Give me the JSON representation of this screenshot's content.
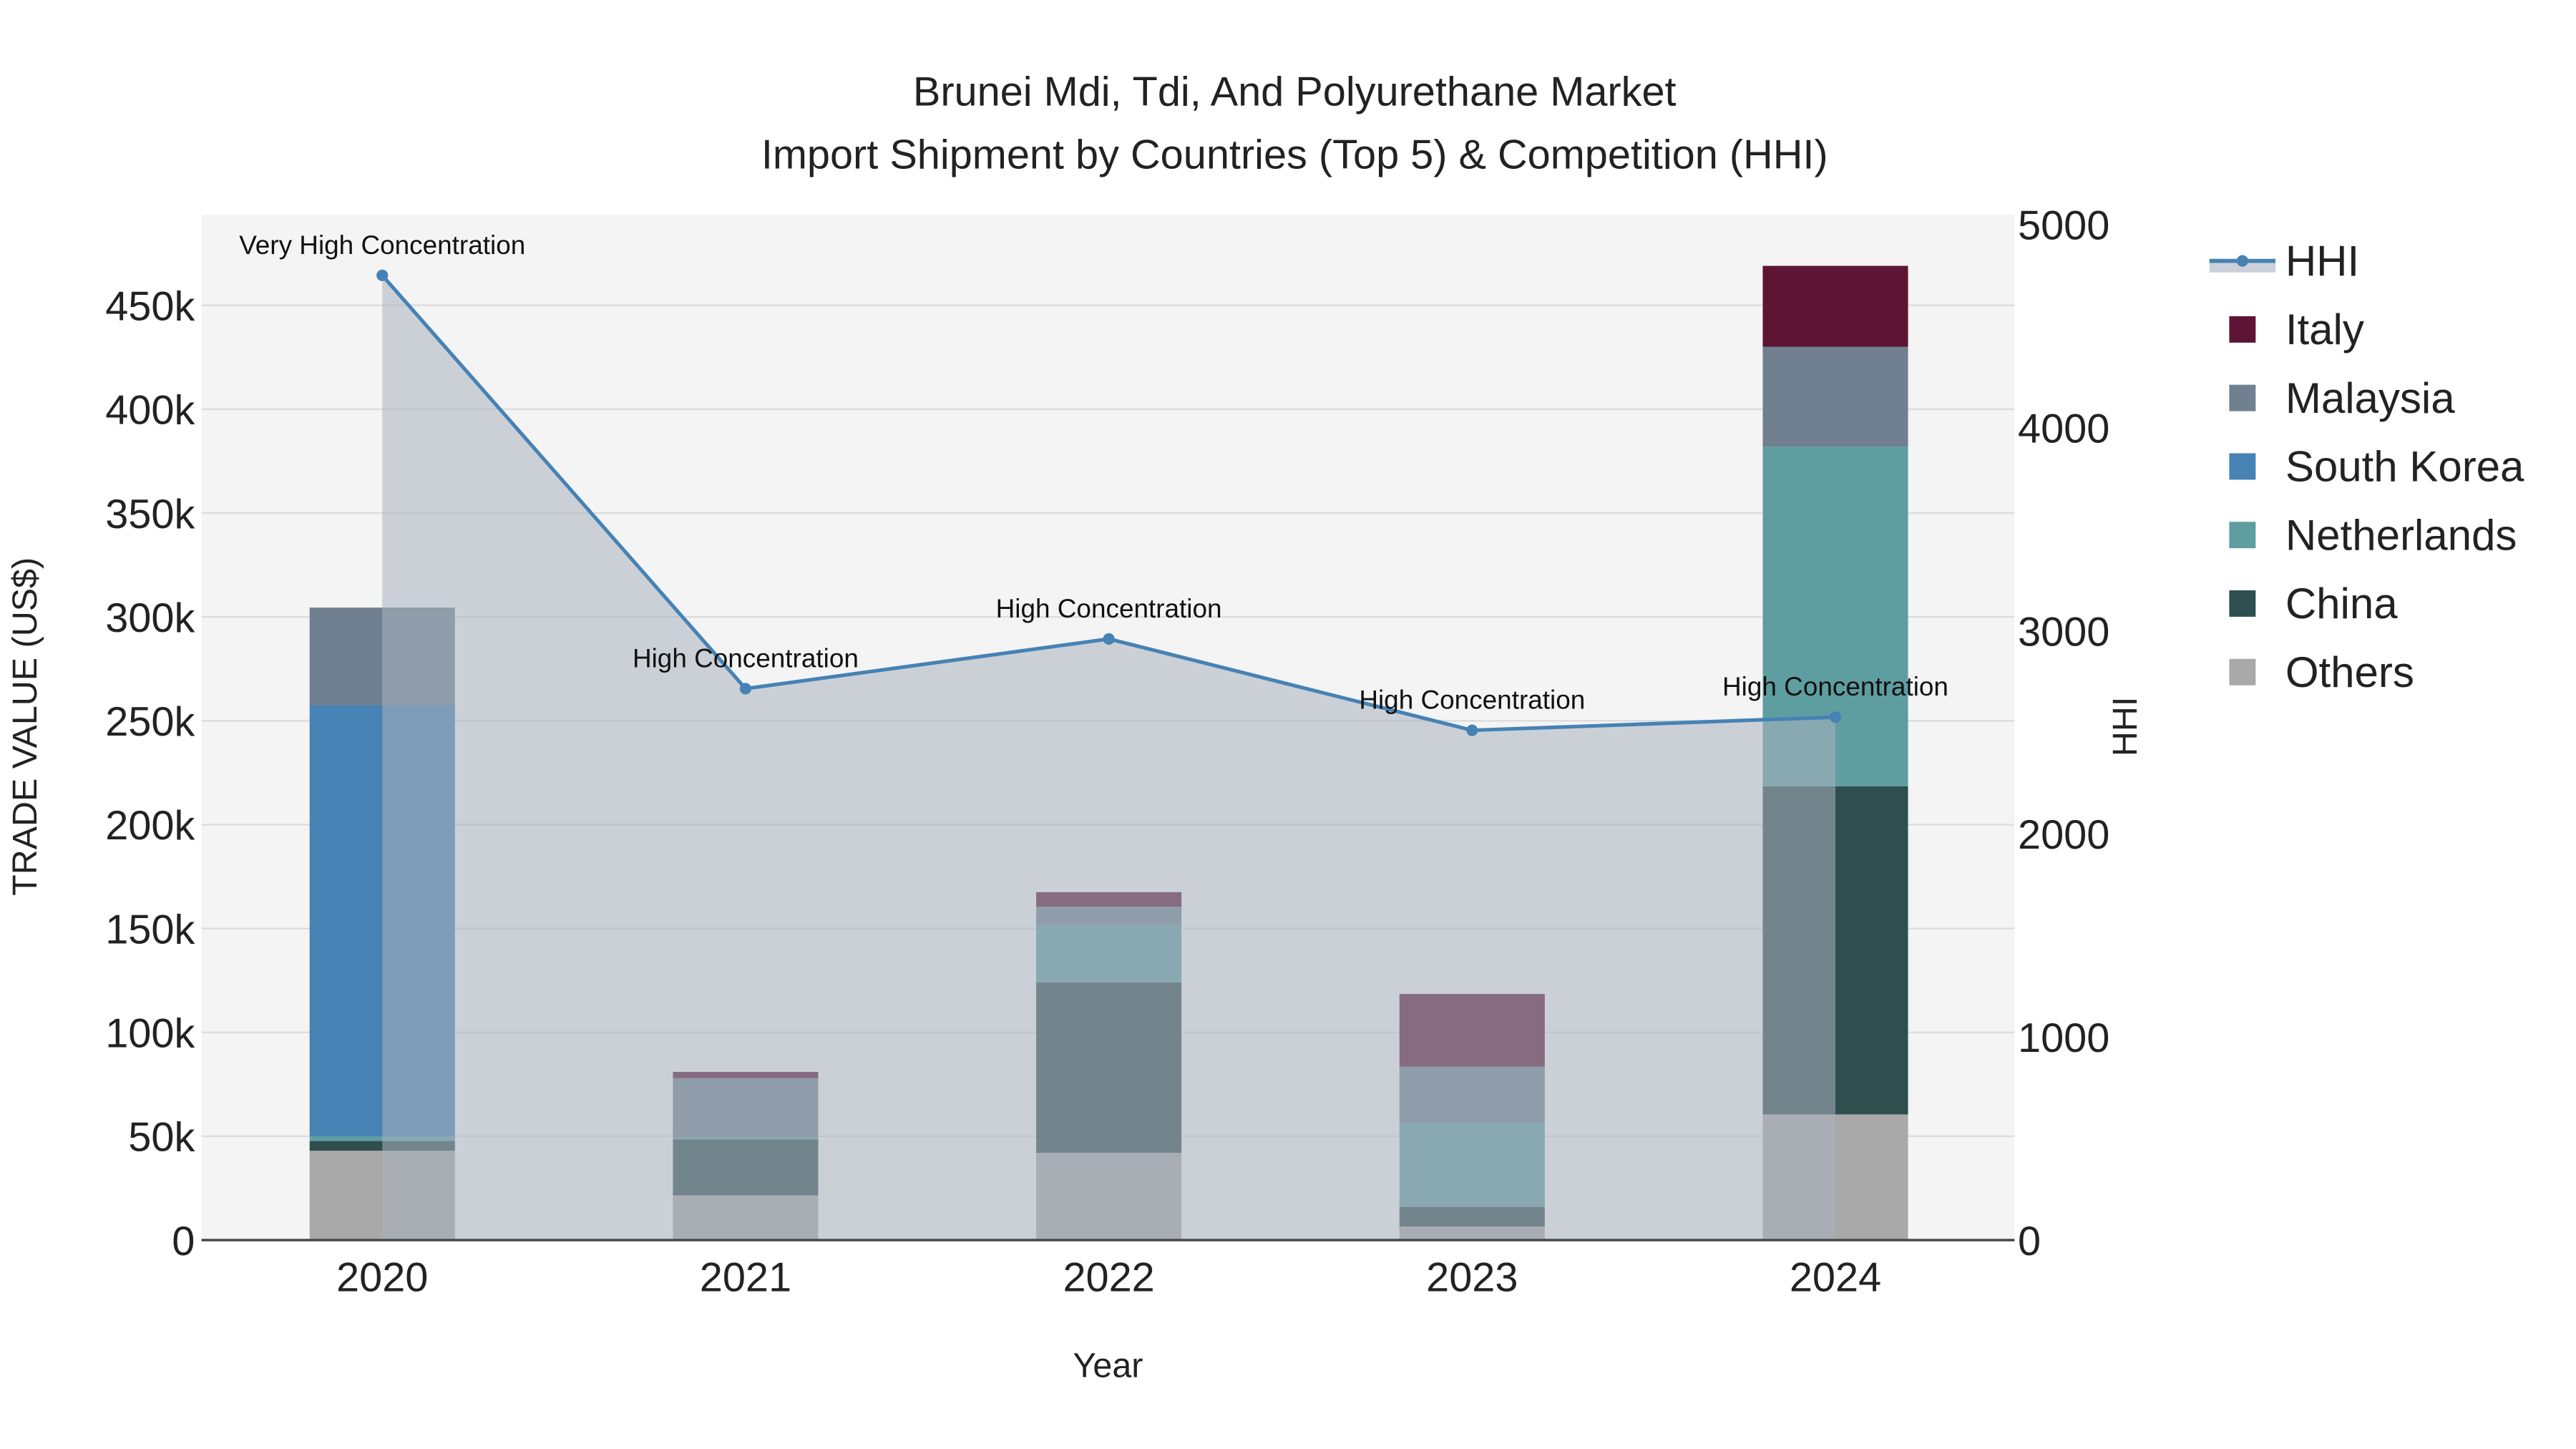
{
  "chart_data": {
    "type": "bar",
    "title_line1": "Brunei Mdi, Tdi, And Polyurethane Market",
    "title_line2": "Import Shipment by Countries (Top 5) & Competition (HHI)",
    "xlabel": "Year",
    "ylabel": "TRADE VALUE (US$)",
    "y2label": "HHI",
    "categories": [
      "2020",
      "2021",
      "2022",
      "2023",
      "2024"
    ],
    "ylim": [
      0,
      490000
    ],
    "y2lim": [
      0,
      5000
    ],
    "yticks": [
      0,
      50000,
      100000,
      150000,
      200000,
      250000,
      300000,
      350000,
      400000,
      450000
    ],
    "ytick_labels": [
      "0",
      "50k",
      "100k",
      "150k",
      "200k",
      "250k",
      "300k",
      "350k",
      "400k",
      "450k"
    ],
    "y2ticks": [
      0,
      1000,
      2000,
      3000,
      4000,
      5000
    ],
    "y2tick_labels": [
      "0",
      "1000",
      "2000",
      "3000",
      "4000",
      "5000"
    ],
    "series": [
      {
        "name": "Others",
        "color": "#a9a9a9",
        "values": [
          43000,
          21500,
          42000,
          6500,
          60500
        ]
      },
      {
        "name": "China",
        "color": "#2f4f4f",
        "values": [
          4700,
          27000,
          82000,
          9500,
          158000
        ]
      },
      {
        "name": "Netherlands",
        "color": "#5f9ea0",
        "values": [
          2300,
          1000,
          28000,
          40500,
          163500
        ]
      },
      {
        "name": "South Korea",
        "color": "#4682b4",
        "values": [
          207500,
          0,
          0,
          0,
          0
        ]
      },
      {
        "name": "Malaysia",
        "color": "#708090",
        "values": [
          47000,
          28500,
          8500,
          27000,
          48000
        ]
      },
      {
        "name": "Italy",
        "color": "#5e1434",
        "values": [
          0,
          3000,
          7000,
          35000,
          39000
        ]
      }
    ],
    "hhi": {
      "name": "HHI",
      "color": "#4682b4",
      "values": [
        4750,
        2715,
        2960,
        2510,
        2575
      ],
      "labels": [
        "Very High Concentration",
        "High Concentration",
        "High Concentration",
        "High Concentration",
        "High Concentration"
      ]
    },
    "legend_order": [
      "HHI",
      "Italy",
      "Malaysia",
      "South Korea",
      "Netherlands",
      "China",
      "Others"
    ],
    "legend_placement": "right",
    "grid": true
  }
}
